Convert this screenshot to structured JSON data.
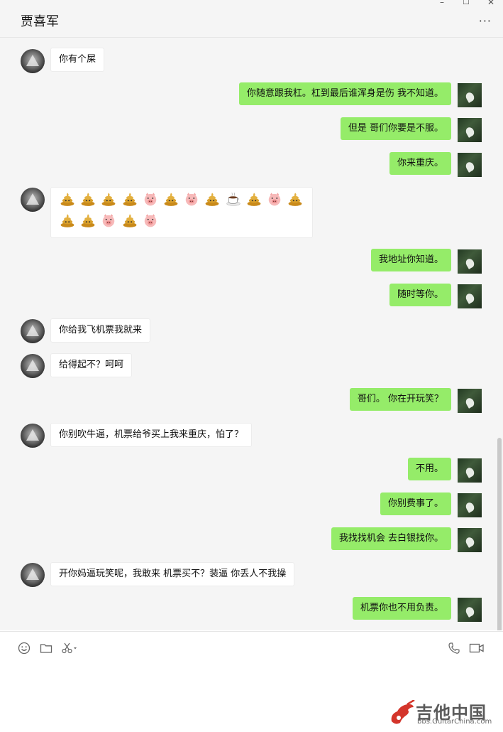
{
  "header": {
    "title": "贾喜军",
    "minimize_glyph": "–",
    "maximize_glyph": "☐",
    "close_glyph": "✕",
    "more_glyph": "···"
  },
  "messages": [
    {
      "side": "in",
      "text": "你有个屎"
    },
    {
      "side": "out",
      "text": "你随意跟我杠。杠到最后谁浑身是伤  我不知道。"
    },
    {
      "side": "out",
      "text": "但是 哥们你要是不服。"
    },
    {
      "side": "out",
      "text": "你来重庆。"
    },
    {
      "side": "in",
      "type": "emoji",
      "emojis_row1": [
        "poop",
        "poop",
        "poop",
        "poop",
        "pig",
        "poop",
        "pig",
        "poop",
        "coffee",
        "poop",
        "pig",
        "poop"
      ],
      "emojis_row2": [
        "poop",
        "poop",
        "pig",
        "poop",
        "pig"
      ]
    },
    {
      "side": "out",
      "text": "我地址你知道。"
    },
    {
      "side": "out",
      "text": "随时等你。"
    },
    {
      "side": "in",
      "text": "你给我飞机票我就来"
    },
    {
      "side": "in",
      "text": "给得起不？呵呵"
    },
    {
      "side": "out",
      "text": "哥们。 你在开玩笑？"
    },
    {
      "side": "in",
      "text": "你别吹牛逼，机票给爷买上我来重庆，怕了？"
    },
    {
      "side": "out",
      "text": "不用。"
    },
    {
      "side": "out",
      "text": "你别费事了。"
    },
    {
      "side": "out",
      "text": "我找找机会 去白银找你。"
    },
    {
      "side": "in",
      "text": "开你妈逼玩笑呢，我敢来 机票买不？装逼 你丢人不我操"
    },
    {
      "side": "out",
      "text": "机票你也不用负责。"
    }
  ],
  "toolbar": {
    "icons": [
      "emoji-icon",
      "folder-icon",
      "scissors-icon",
      "phone-icon",
      "video-icon"
    ]
  },
  "watermark": {
    "text": "吉他中国",
    "url": "bbs.GuitarChina.com"
  },
  "colors": {
    "outgoing_bubble": "#95ec69",
    "incoming_bubble": "#ffffff",
    "chat_background": "#f5f5f5"
  }
}
